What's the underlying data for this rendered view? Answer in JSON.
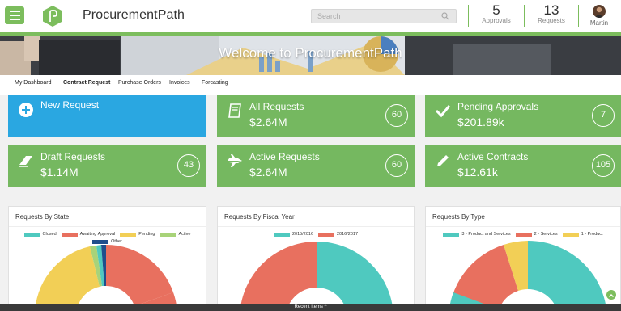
{
  "header": {
    "app_title": "ProcurementPath",
    "search_placeholder": "Search",
    "approvals_count": "5",
    "approvals_label": "Approvals",
    "requests_count": "13",
    "requests_label": "Requests",
    "user_name": "Martin"
  },
  "hero": {
    "title": "Welcome to ProcurementPath"
  },
  "tabs": [
    {
      "label": "My Dashboard"
    },
    {
      "label": "Contract Request"
    },
    {
      "label": "Purchase Orders"
    },
    {
      "label": "Invoices"
    },
    {
      "label": "Forcasting"
    }
  ],
  "cards": [
    {
      "label": "New Request",
      "value": "",
      "count": "",
      "icon": "plus-circle-icon",
      "color": "#2aa7e1"
    },
    {
      "label": "All Requests",
      "value": "$2.64M",
      "count": "60",
      "icon": "book-icon",
      "color": "#75b860"
    },
    {
      "label": "Pending Approvals",
      "value": "$201.89k",
      "count": "7",
      "icon": "checkmark-icon",
      "color": "#75b860"
    },
    {
      "label": "Draft Requests",
      "value": "$1.14M",
      "count": "43",
      "icon": "eraser-icon",
      "color": "#75b860"
    },
    {
      "label": "Active Requests",
      "value": "$2.64M",
      "count": "60",
      "icon": "airplane-icon",
      "color": "#75b860"
    },
    {
      "label": "Active Contracts",
      "value": "$12.61k",
      "count": "105",
      "icon": "pencil-icon",
      "color": "#75b860"
    }
  ],
  "panels": [
    {
      "title": "Requests By State",
      "legend": [
        {
          "name": "Closed",
          "color": "#4fc9bf"
        },
        {
          "name": "Awaiting Approval",
          "color": "#e8705f"
        },
        {
          "name": "Pending",
          "color": "#f2cf56"
        },
        {
          "name": "Active",
          "color": "#a8d379"
        },
        {
          "name": "Other",
          "color": "#1f4e8c"
        }
      ]
    },
    {
      "title": "Requests By Fiscal Year",
      "legend": [
        {
          "name": "2015/2016",
          "color": "#4fc9bf"
        },
        {
          "name": "2016/2017",
          "color": "#e8705f"
        }
      ]
    },
    {
      "title": "Requests By Type",
      "legend": [
        {
          "name": "3 - Product and Services",
          "color": "#4fc9bf"
        },
        {
          "name": "2 - Services",
          "color": "#e8705f"
        },
        {
          "name": "1 - Product",
          "color": "#f2cf56"
        }
      ]
    }
  ],
  "footer": {
    "label": "Recent Items ^"
  },
  "colors": {
    "accent": "#7cbd5d",
    "blue_card": "#2aa7e1",
    "green_card": "#75b860"
  }
}
